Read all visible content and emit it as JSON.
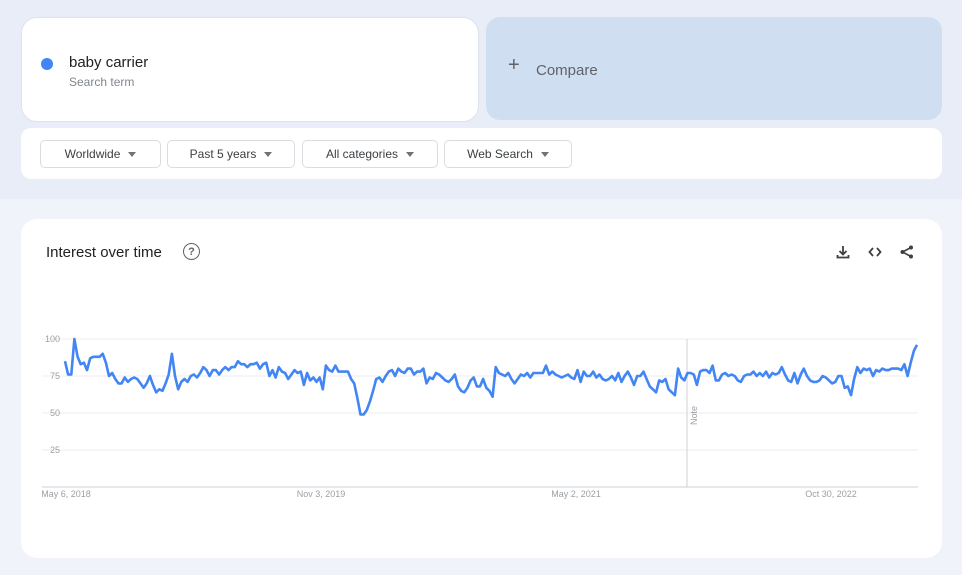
{
  "search_term": {
    "name": "baby carrier",
    "sub_label": "Search term",
    "color": "#4285f4"
  },
  "compare": {
    "plus_icon": "plus-icon",
    "label": "Compare"
  },
  "filters": [
    {
      "label": "Worldwide"
    },
    {
      "label": "Past 5 years"
    },
    {
      "label": "All categories"
    },
    {
      "label": "Web Search"
    }
  ],
  "chart_panel": {
    "title": "Interest over time",
    "help_icon": "?",
    "actions": [
      "download-icon",
      "embed-code-icon",
      "share-icon"
    ],
    "note_label": "Note"
  },
  "chart_data": {
    "type": "line",
    "title": "Interest over time",
    "xlabel": "",
    "ylabel": "",
    "ylim": [
      0,
      100
    ],
    "yticks": [
      25,
      50,
      75,
      100
    ],
    "xtick_labels": [
      "May 6, 2018",
      "Nov 3, 2019",
      "May 2, 2021",
      "Oct 30, 2022"
    ],
    "x_start": "May 6, 2018",
    "x_end": "Apr 2023",
    "grid": true,
    "legend": "none",
    "note_marker_fraction": 0.73,
    "series": [
      {
        "name": "baby carrier",
        "color": "#4285f4",
        "values": [
          85,
          76,
          76,
          100,
          88,
          83,
          84,
          79,
          87,
          88,
          88,
          88,
          90,
          84,
          75,
          77,
          73,
          70,
          70,
          74,
          71,
          73,
          74,
          73,
          70,
          67,
          70,
          75,
          69,
          64,
          66,
          65,
          70,
          76,
          90,
          75,
          66,
          71,
          73,
          71,
          75,
          76,
          74,
          77,
          81,
          79,
          75,
          79,
          79,
          76,
          79,
          81,
          79,
          81,
          81,
          85,
          83,
          83,
          81,
          83,
          83,
          84,
          80,
          83,
          84,
          75,
          79,
          74,
          81,
          78,
          77,
          73,
          76,
          79,
          77,
          78,
          69,
          77,
          72,
          74,
          71,
          74,
          66,
          82,
          79,
          78,
          82,
          78,
          78,
          78,
          78,
          73,
          70,
          60,
          49,
          49,
          52,
          58,
          65,
          73,
          74,
          71,
          75,
          78,
          79,
          75,
          80,
          78,
          77,
          80,
          80,
          76,
          78,
          78,
          80,
          70,
          74,
          73,
          77,
          76,
          74,
          72,
          71,
          73,
          76,
          68,
          65,
          64,
          67,
          72,
          74,
          68,
          68,
          73,
          67,
          65,
          61,
          81,
          77,
          76,
          75,
          77,
          73,
          70,
          73,
          76,
          75,
          77,
          74,
          77,
          77,
          77,
          77,
          82,
          76,
          78,
          76,
          75,
          74,
          75,
          76,
          74,
          73,
          79,
          71,
          78,
          75,
          75,
          78,
          74,
          76,
          73,
          72,
          73,
          75,
          72,
          77,
          71,
          75,
          78,
          74,
          69,
          75,
          75,
          78,
          73,
          68,
          66,
          64,
          72,
          71,
          73,
          66,
          64,
          62,
          80,
          74,
          72,
          77,
          77,
          76,
          69,
          78,
          79,
          79,
          77,
          82,
          72,
          72,
          76,
          77,
          75,
          76,
          75,
          72,
          71,
          75,
          76,
          76,
          78,
          75,
          77,
          75,
          78,
          74,
          77,
          76,
          77,
          81,
          76,
          72,
          71,
          77,
          70,
          76,
          80,
          75,
          72,
          71,
          71,
          72,
          75,
          74,
          72,
          70,
          71,
          75,
          75,
          67,
          68,
          62,
          73,
          81,
          77,
          80,
          79,
          80,
          75,
          79,
          78,
          80,
          79,
          79,
          80,
          80,
          80,
          79,
          83,
          75,
          84,
          92,
          96
        ]
      }
    ]
  }
}
